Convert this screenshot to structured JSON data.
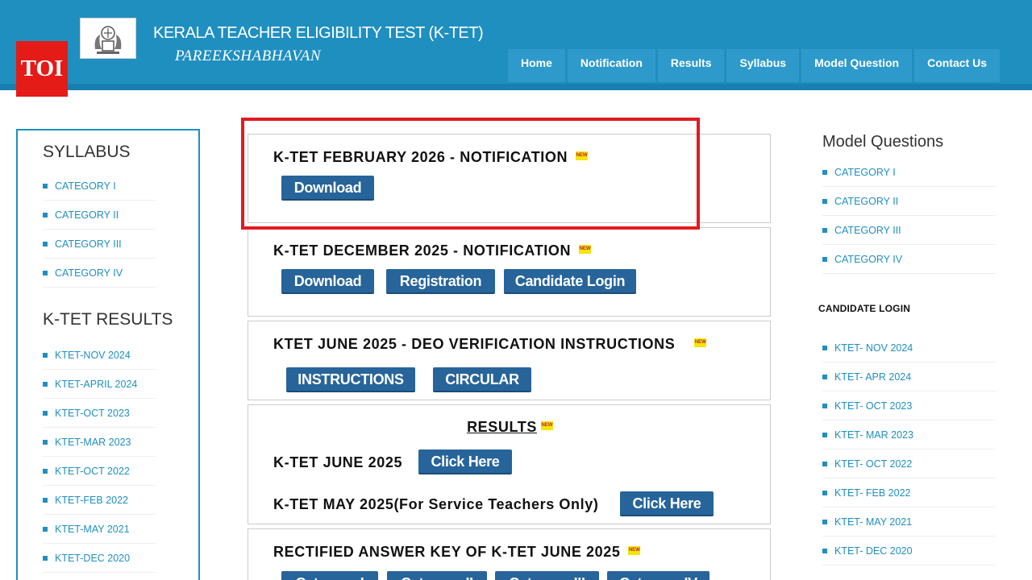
{
  "header": {
    "title": "KERALA TEACHER ELIGIBILITY TEST (K-TET)",
    "subtitle": "PAREEKSHABHAVAN",
    "badge": "TOI",
    "nav": [
      "Home",
      "Notification",
      "Results",
      "Syllabus",
      "Model Question",
      "Contact Us"
    ]
  },
  "left": {
    "syllabus_heading": "SYLLABUS",
    "syllabus": [
      "CATEGORY I",
      "CATEGORY II",
      "CATEGORY III",
      "CATEGORY IV"
    ],
    "results_heading": "K-TET RESULTS",
    "results": [
      "KTET-NOV 2024",
      "KTET-APRIL 2024",
      "KTET-OCT 2023",
      "KTET-MAR 2023",
      "KTET-OCT 2022",
      "KTET-FEB 2022",
      "KTET-MAY 2021",
      "KTET-DEC 2020"
    ]
  },
  "right": {
    "model_heading": "Model Questions",
    "model": [
      "CATEGORY I",
      "CATEGORY II",
      "CATEGORY III",
      "CATEGORY IV"
    ],
    "login_heading": "CANDIDATE LOGIN",
    "login": [
      "KTET- NOV 2024",
      "KTET- APR 2024",
      "KTET- OCT 2023",
      "KTET- MAR 2023",
      "KTET- OCT 2022",
      "KTET- FEB 2022",
      "KTET- MAY 2021",
      "KTET- DEC 2020"
    ]
  },
  "new_badge": "NEW",
  "panels": {
    "feb2026": {
      "title": "K-TET FEBRUARY 2026 - NOTIFICATION",
      "download": "Download"
    },
    "dec2025": {
      "title": "K-TET DECEMBER 2025 - NOTIFICATION",
      "download": "Download",
      "registration": "Registration",
      "login": "Candidate Login"
    },
    "june_deo": {
      "title": "KTET JUNE 2025 - DEO VERIFICATION INSTRUCTIONS",
      "instructions": "INSTRUCTIONS",
      "circular": "CIRCULAR"
    },
    "results": {
      "heading": "RESULTS",
      "row1": "K-TET JUNE 2025",
      "row1_btn": "Click Here",
      "row2": "K-TET MAY 2025(For Service Teachers Only)",
      "row2_btn": "Click Here"
    },
    "answer_key": {
      "title": "RECTIFIED ANSWER KEY OF K-TET JUNE 2025",
      "buttons": [
        "Category I",
        "Category II",
        "Category III",
        "Category IV"
      ]
    }
  }
}
